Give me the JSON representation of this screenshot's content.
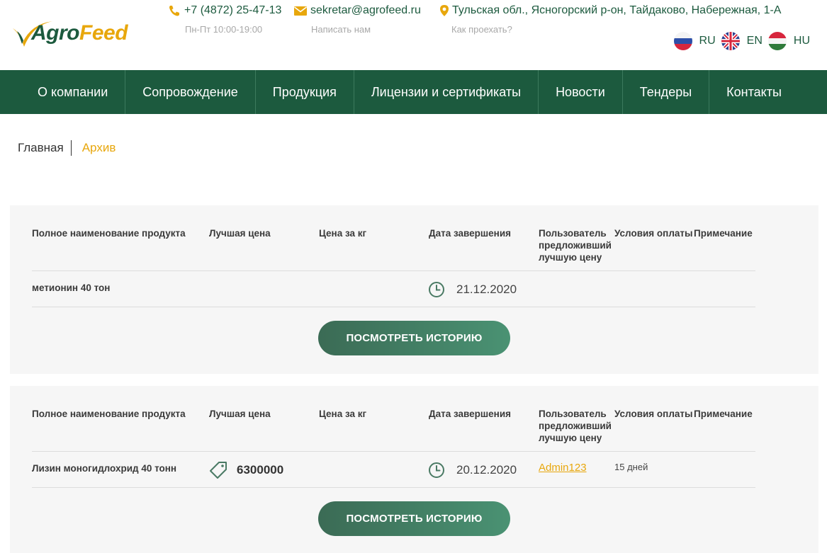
{
  "header": {
    "logo": {
      "part1": "Agro",
      "part2": "Feed"
    },
    "phone": {
      "value": "+7 (4872) 25-47-13",
      "sub": "Пн-Пт 10:00-19:00"
    },
    "email": {
      "value": "sekretar@agrofeed.ru",
      "sub": "Написать нам"
    },
    "address": {
      "value": "Тульская обл., Ясногорский р-он, Тайдаково, Набережная, 1-А",
      "sub": "Как проехать?"
    },
    "languages": [
      {
        "code": "RU",
        "icon": "russia-flag-icon"
      },
      {
        "code": "EN",
        "icon": "uk-flag-icon"
      },
      {
        "code": "HU",
        "icon": "hungary-flag-icon"
      }
    ]
  },
  "nav": {
    "items": [
      "О компании",
      "Сопровождение",
      "Продукция",
      "Лицензии и сертификаты",
      "Новости",
      "Тендеры",
      "Контакты"
    ]
  },
  "breadcrumb": {
    "home": "Главная",
    "current": "Архив"
  },
  "table_headers": [
    "Полное наименование продукта",
    "Лучшая цена",
    "Цена за кг",
    "Дата завершения",
    "Пользователь предложивший лучшую цену",
    "Условия оплаты",
    "Примечание"
  ],
  "tenders": [
    {
      "name": "метионин 40 тон",
      "best_price": "",
      "price_per_kg": "",
      "end_date": "21.12.2020",
      "user": "",
      "payment_terms": "",
      "note": "",
      "button": "ПОСМОТРЕТЬ ИСТОРИЮ"
    },
    {
      "name": "Лизин моногидлохрид 40 тонн",
      "best_price": "6300000",
      "price_per_kg": "",
      "end_date": "20.12.2020",
      "user": "Admin123",
      "payment_terms": "15 дней",
      "note": "",
      "button": "ПОСМОТРЕТЬ ИСТОРИЮ"
    }
  ],
  "colors": {
    "brand_green": "#1c5a3e",
    "accent_orange": "#e8a70c",
    "card_bg": "#f6f6f6"
  }
}
